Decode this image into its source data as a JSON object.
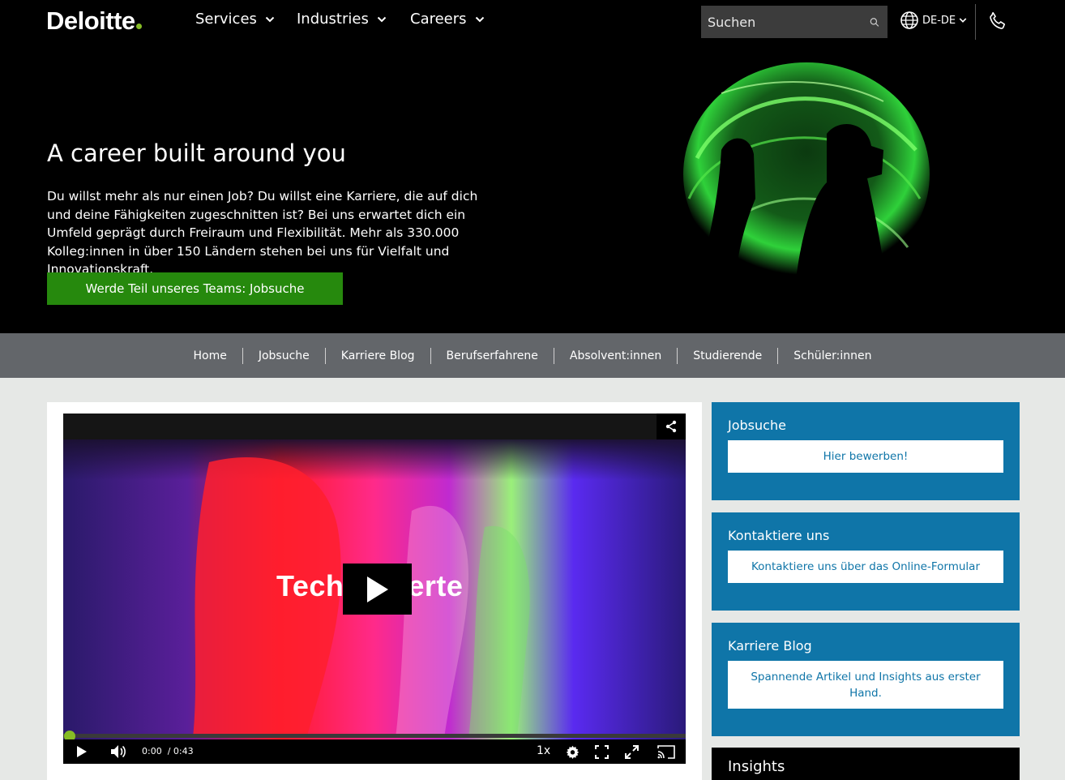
{
  "header": {
    "logo": "Deloitte",
    "nav": [
      {
        "label": "Services"
      },
      {
        "label": "Industries"
      },
      {
        "label": "Careers"
      }
    ],
    "search": {
      "placeholder": "Suchen"
    },
    "language": "DE-DE"
  },
  "hero": {
    "title": "A career built around you",
    "text": "Du willst mehr als nur einen Job? Du willst eine Karriere, die auf dich und deine Fähigkeiten zugeschnitten ist? Bei uns erwartet dich ein Umfeld geprägt durch Freiraum und Flexibilität. Mehr als 330.000 Kolleg:innen in über 150 Ländern stehen bei uns für Vielfalt und Innovationskraft.",
    "button": "Werde Teil unseres Teams: Jobsuche"
  },
  "subnav": {
    "items": [
      {
        "label": "Home"
      },
      {
        "label": "Jobsuche"
      },
      {
        "label": "Karriere Blog"
      },
      {
        "label": "Berufserfahrene"
      },
      {
        "label": "Absolvent:innen"
      },
      {
        "label": "Studierende"
      },
      {
        "label": "Schüler:innen"
      }
    ]
  },
  "video": {
    "caption_left": "Tech",
    "caption_right": "erte",
    "current_time": "0:00",
    "duration": "/ 0:43",
    "speed": "1x",
    "progress": 0.0
  },
  "sidebar": {
    "cards": [
      {
        "title": "Jobsuche",
        "button": "Hier bewerben!"
      },
      {
        "title": "Kontaktiere uns",
        "button": "Kontaktiere uns über das Online-Formular"
      },
      {
        "title": "Karriere Blog",
        "button": "Spannende Artikel und Insights aus erster Hand."
      }
    ],
    "insights_title": "Insights"
  },
  "colors": {
    "brand_green": "#86bc25",
    "button_green": "#26890d",
    "sidebar_blue": "#0f75a8",
    "subnav_gray": "#63666a"
  }
}
